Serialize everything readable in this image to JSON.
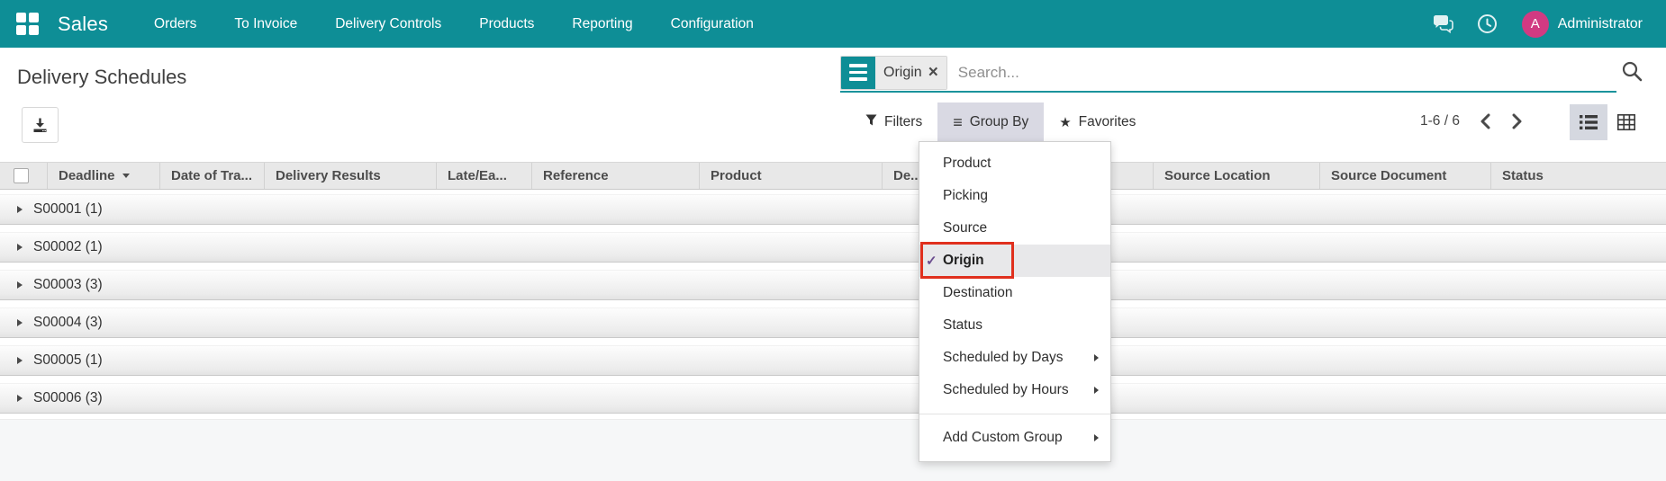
{
  "navbar": {
    "app_name": "Sales",
    "menu_items": [
      "Orders",
      "To Invoice",
      "Delivery Controls",
      "Products",
      "Reporting",
      "Configuration"
    ],
    "user": {
      "initial": "A",
      "name": "Administrator"
    }
  },
  "control_panel": {
    "title": "Delivery Schedules",
    "search": {
      "facet_label": "Origin",
      "placeholder": "Search..."
    },
    "buttons": {
      "filters": "Filters",
      "group_by": "Group By",
      "favorites": "Favorites"
    },
    "pager": {
      "text": "1-6 / 6"
    }
  },
  "table": {
    "columns": [
      "Deadline",
      "Date of Tra...",
      "Delivery Results",
      "Late/Ea...",
      "Reference",
      "Product",
      "De...",
      "Source Location",
      "Source Document",
      "Status"
    ],
    "groups": [
      {
        "label": "S00001 (1)"
      },
      {
        "label": "S00002 (1)"
      },
      {
        "label": "S00003 (3)"
      },
      {
        "label": "S00004 (3)"
      },
      {
        "label": "S00005 (1)"
      },
      {
        "label": "S00006 (3)"
      }
    ]
  },
  "group_by_menu": {
    "items": [
      {
        "label": "Product"
      },
      {
        "label": "Picking"
      },
      {
        "label": "Source"
      },
      {
        "label": "Origin",
        "checked": true
      },
      {
        "label": "Destination"
      },
      {
        "label": "Status"
      },
      {
        "label": "Scheduled by Days",
        "submenu": true
      },
      {
        "label": "Scheduled by Hours",
        "submenu": true
      }
    ],
    "footer_item": {
      "label": "Add Custom Group",
      "submenu": true
    }
  },
  "icons": {
    "favorites_star": "★",
    "group_by_lines": "≡",
    "facet_remove": "×",
    "checkmark": "✓"
  },
  "colors": {
    "accent_teal": "#0e8e96",
    "avatar_pink": "#d13a82",
    "annotation_red": "#e0301e",
    "checkmark_purple": "#6b4d8f"
  }
}
